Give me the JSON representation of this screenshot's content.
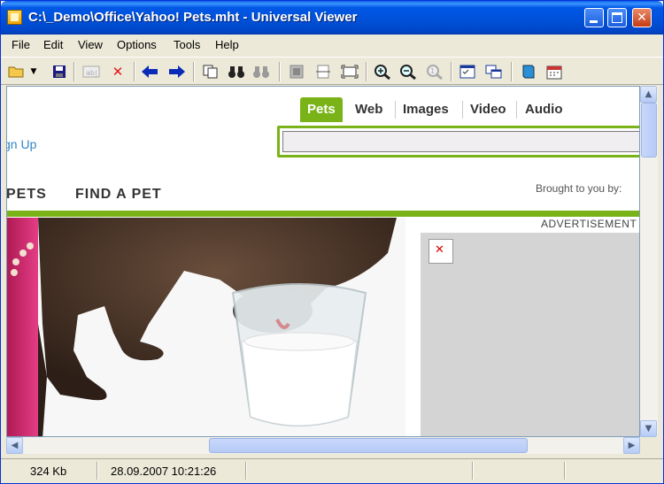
{
  "window": {
    "title": "C:\\_Demo\\Office\\Yahoo! Pets.mht - Universal Viewer"
  },
  "menu": [
    "File",
    "Edit",
    "View",
    "Options",
    "Tools",
    "Help"
  ],
  "toolbar": {
    "icons": [
      "open-folder-icon",
      "dropdown-arrow-icon",
      "save-icon",
      "edit-text-icon",
      "close-red-x-icon",
      "back-arrow-icon",
      "forward-arrow-icon",
      "copy-icon",
      "find-binoculars-icon",
      "find-next-icon",
      "fit-page-icon",
      "fit-width-icon",
      "fit-window-icon",
      "zoom-in-icon",
      "zoom-out-icon",
      "zoom-original-icon",
      "options-icon",
      "windows-icon",
      "book-icon",
      "calendar-icon"
    ]
  },
  "page": {
    "tabs": [
      "Pets",
      "Web",
      "Images",
      "Video",
      "Audio"
    ],
    "active_tab": "Pets",
    "signup": "gn Up",
    "nav": [
      "PETS",
      "FIND A PET"
    ],
    "brought": "Brought to you by:",
    "ad_label": "ADVERTISEMENT",
    "colors": {
      "green": "#7ab317",
      "link": "#2f86c4"
    }
  },
  "status": {
    "size": "324 Kb",
    "date": "28.09.2007 10:21:26"
  }
}
